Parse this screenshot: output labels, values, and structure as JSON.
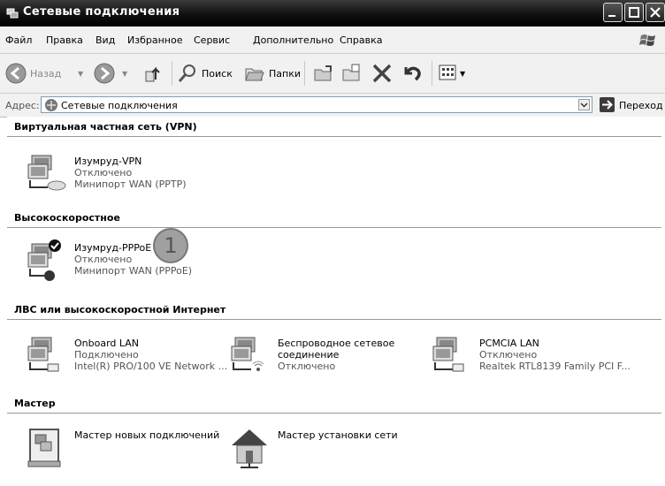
{
  "window": {
    "title": "Сетевые подключения"
  },
  "menu": [
    "Файл",
    "Правка",
    "Вид",
    "Избранное",
    "Сервис",
    "Дополнительно",
    "Справка"
  ],
  "toolbar": {
    "back_label": "Назад",
    "search_label": "Поиск",
    "folders_label": "Папки"
  },
  "address": {
    "label": "Адрес:",
    "value": "Сетевые подключения",
    "go_label": "Переход"
  },
  "groups": [
    {
      "title": "Виртуальная частная сеть (VPN)"
    },
    {
      "title": "Высокоскоростное"
    },
    {
      "title": "ЛВС или высокоскоростной Интернет"
    },
    {
      "title": "Мастер"
    }
  ],
  "connections": {
    "vpn": {
      "name": "Изумруд-VPN",
      "status": "Отключено",
      "device": "Минипорт WAN (PPTP)"
    },
    "pppoe": {
      "name": "Изумруд-PPPoE",
      "status": "Отключено",
      "device": "Минипорт WAN (PPPoE)"
    },
    "lan": {
      "name": "Onboard LAN",
      "status": "Подключено",
      "device": "Intel(R) PRO/100 VE Network ..."
    },
    "wireless": {
      "name": "Беспроводное сетевое",
      "name2": "соединение",
      "status": "Отключено"
    },
    "pcmcia": {
      "name": "PCMCIA LAN",
      "status": "Отключено",
      "device": "Realtek RTL8139 Family PCI F..."
    }
  },
  "wizards": {
    "new_connection": "Мастер новых подключений",
    "network_setup": "Мастер установки сети"
  },
  "callout": {
    "number": "1"
  }
}
